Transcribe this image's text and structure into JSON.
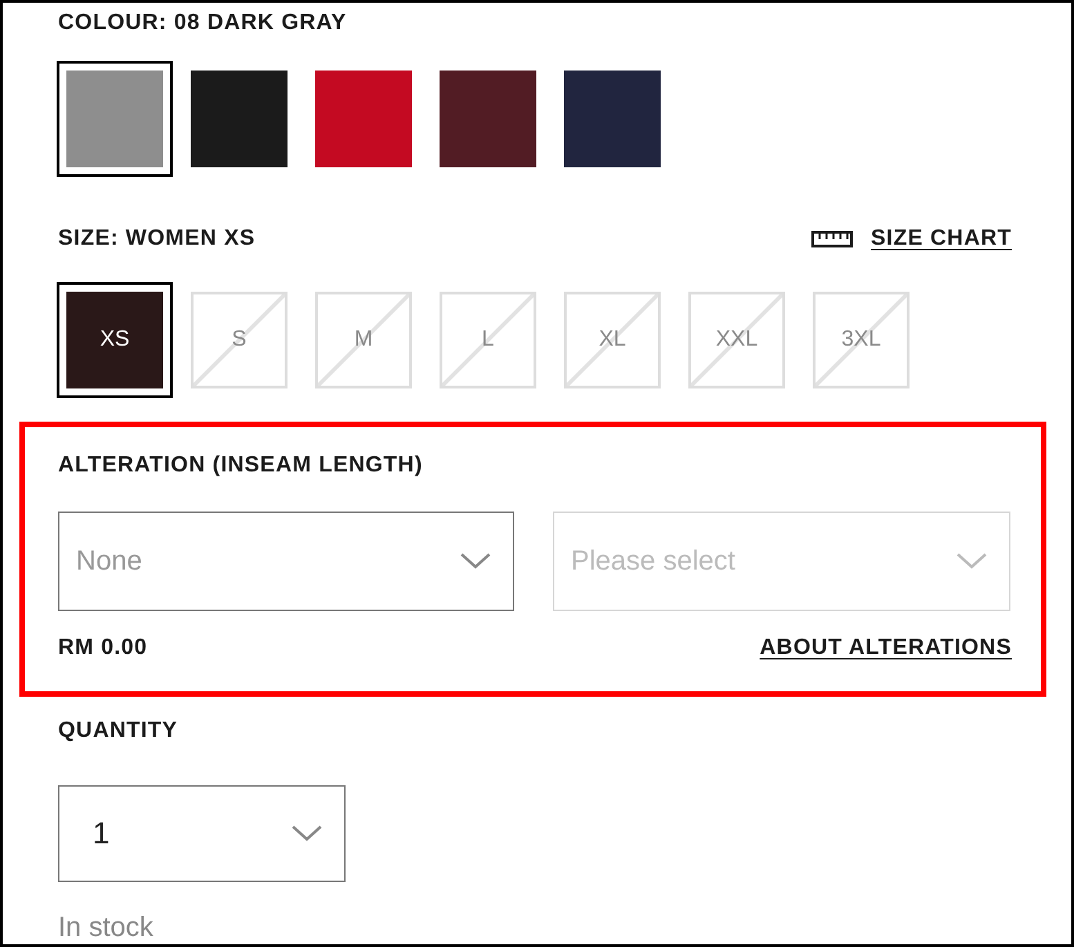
{
  "colour": {
    "label": "COLOUR: 08 DARK GRAY",
    "swatches": [
      {
        "color": "#8e8e8e",
        "selected": true
      },
      {
        "color": "#1b1b1b",
        "selected": false
      },
      {
        "color": "#c40a22",
        "selected": false
      },
      {
        "color": "#521c24",
        "selected": false
      },
      {
        "color": "#21253f",
        "selected": false
      }
    ]
  },
  "size": {
    "label": "SIZE: WOMEN XS",
    "chart_link": "SIZE CHART",
    "options": [
      {
        "label": "XS",
        "selected": true,
        "available": true
      },
      {
        "label": "S",
        "selected": false,
        "available": false
      },
      {
        "label": "M",
        "selected": false,
        "available": false
      },
      {
        "label": "L",
        "selected": false,
        "available": false
      },
      {
        "label": "XL",
        "selected": false,
        "available": false
      },
      {
        "label": "XXL",
        "selected": false,
        "available": false
      },
      {
        "label": "3XL",
        "selected": false,
        "available": false
      }
    ]
  },
  "alteration": {
    "highlighted": true,
    "label": "ALTERATION (INSEAM LENGTH)",
    "selects": [
      {
        "value": "None",
        "disabled": false
      },
      {
        "placeholder": "Please select",
        "disabled": true
      }
    ],
    "price": "RM 0.00",
    "link": "ABOUT ALTERATIONS"
  },
  "quantity": {
    "label": "QUANTITY",
    "value": "1",
    "stock": "In stock"
  }
}
